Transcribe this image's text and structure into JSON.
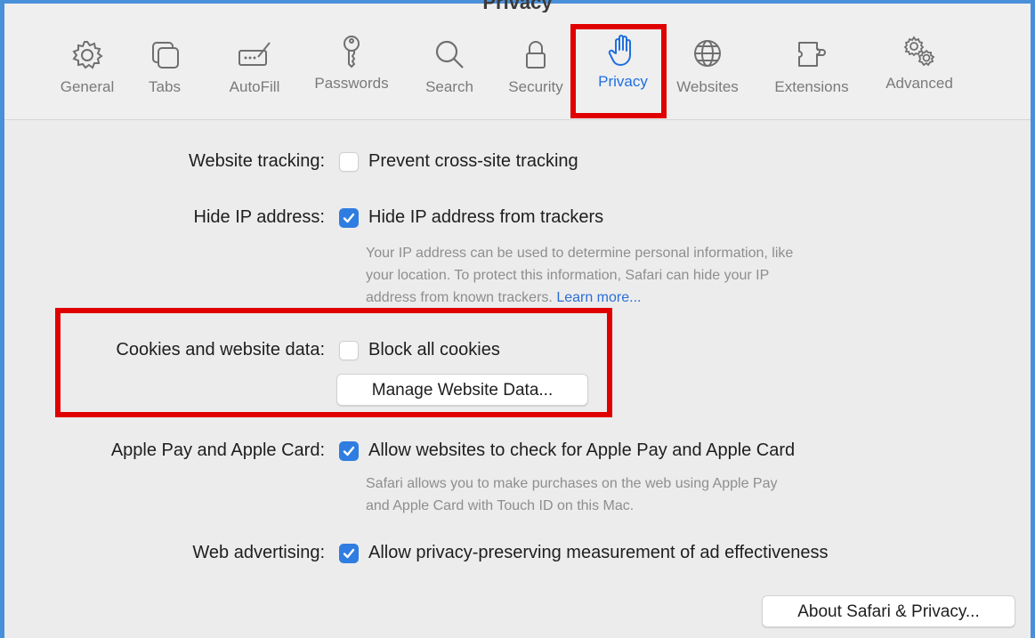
{
  "window": {
    "title": "Privacy"
  },
  "toolbar": {
    "tabs": [
      {
        "label": "General",
        "icon": "gear-icon"
      },
      {
        "label": "Tabs",
        "icon": "tabs-icon"
      },
      {
        "label": "AutoFill",
        "icon": "autofill-icon"
      },
      {
        "label": "Passwords",
        "icon": "key-icon"
      },
      {
        "label": "Search",
        "icon": "search-icon"
      },
      {
        "label": "Security",
        "icon": "lock-icon"
      },
      {
        "label": "Privacy",
        "icon": "hand-icon",
        "selected": true
      },
      {
        "label": "Websites",
        "icon": "globe-icon"
      },
      {
        "label": "Extensions",
        "icon": "puzzle-icon"
      },
      {
        "label": "Advanced",
        "icon": "gears-icon"
      }
    ]
  },
  "settings": {
    "website_tracking": {
      "label": "Website tracking:",
      "checkbox_label": "Prevent cross-site tracking",
      "checked": false
    },
    "hide_ip": {
      "label": "Hide IP address:",
      "checkbox_label": "Hide IP address from trackers",
      "checked": true,
      "description_l1": "Your IP address can be used to determine personal information, like",
      "description_l2": "your location. To protect this information, Safari can hide your IP",
      "description_l3": "address from known trackers.",
      "learn_more": "Learn more..."
    },
    "cookies": {
      "label": "Cookies and website data:",
      "checkbox_label": "Block all cookies",
      "checked": false,
      "manage_button": "Manage Website Data..."
    },
    "apple_pay": {
      "label": "Apple Pay and Apple Card:",
      "checkbox_label": "Allow websites to check for Apple Pay and Apple Card",
      "checked": true,
      "description_l1": "Safari allows you to make purchases on the web using Apple Pay",
      "description_l2": "and Apple Card with Touch ID on this Mac."
    },
    "web_advertising": {
      "label": "Web advertising:",
      "checkbox_label": "Allow privacy-preserving measurement of ad effectiveness",
      "checked": true
    }
  },
  "footer": {
    "about_button": "About Safari & Privacy..."
  },
  "colors": {
    "accent": "#2f7de1",
    "highlight": "#e00000",
    "frame": "#4a8fd9"
  }
}
